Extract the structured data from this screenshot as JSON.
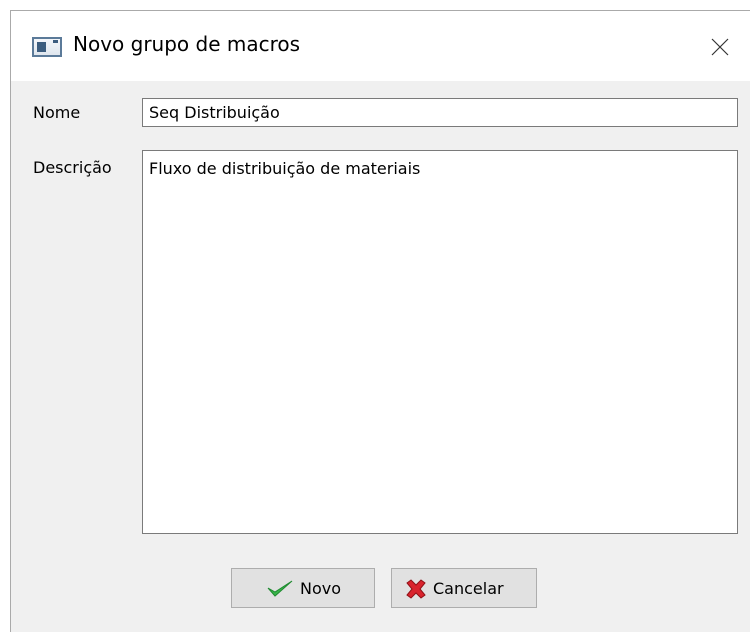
{
  "window": {
    "title": "Novo grupo de macros"
  },
  "form": {
    "name_label": "Nome",
    "name_value": "Seq Distribuição",
    "description_label": "Descrição",
    "description_value": "Fluxo de distribuição de materiais"
  },
  "buttons": {
    "ok_label": "Novo",
    "ok_icon": "green-checkmark-icon",
    "cancel_label": "Cancelar",
    "cancel_icon": "red-x-icon"
  },
  "colors": {
    "dialog_background": "#f0f0f0",
    "titlebar_background": "#ffffff",
    "ok_icon_color": "#39b54a",
    "cancel_icon_color": "#d9232d"
  }
}
